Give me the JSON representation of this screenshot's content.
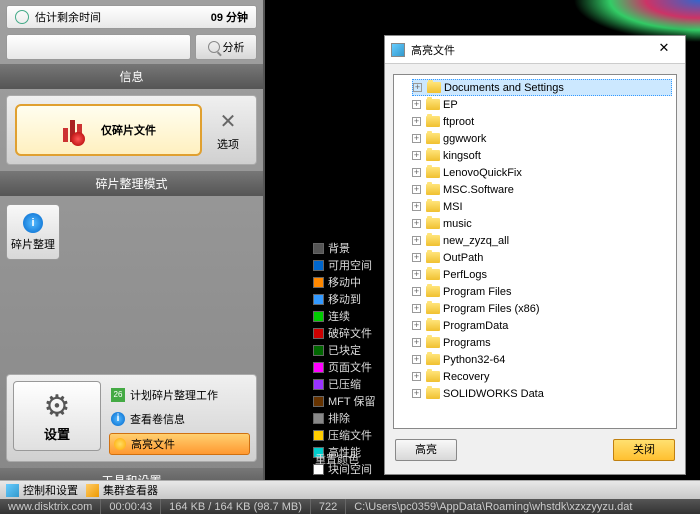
{
  "timer": {
    "label": "估计剩余时间",
    "value": "09 分钟"
  },
  "analyze_btn": "分析",
  "info_header": "信息",
  "mode": {
    "button": "仅碎片文件",
    "options": "选项",
    "header": "碎片整理模式"
  },
  "defrag_btn": "碎片整理",
  "tools": {
    "settings": "设置",
    "schedule": "计划碎片整理工作",
    "volinfo": "查看卷信息",
    "highlight": "高亮文件",
    "header": "工具和设置",
    "cal": "26"
  },
  "legend": [
    {
      "c": "#555555",
      "t": "背景"
    },
    {
      "c": "#0066cc",
      "t": "可用空间"
    },
    {
      "c": "#ff8800",
      "t": "移动中"
    },
    {
      "c": "#3399ff",
      "t": "移动到"
    },
    {
      "c": "#00cc00",
      "t": "连续"
    },
    {
      "c": "#cc0000",
      "t": "破碎文件"
    },
    {
      "c": "#006600",
      "t": "已块定"
    },
    {
      "c": "#ff00ff",
      "t": "页面文件"
    },
    {
      "c": "#9933ff",
      "t": "已压缩"
    },
    {
      "c": "#663300",
      "t": "MFT 保留"
    },
    {
      "c": "#888888",
      "t": "排除"
    },
    {
      "c": "#ffcc00",
      "t": "压缩文件"
    },
    {
      "c": "#00cccc",
      "t": "高性能"
    },
    {
      "c": "#ffffff",
      "t": "块间空间"
    }
  ],
  "reset_colors": "重置颜色",
  "dialog": {
    "title": "高亮文件",
    "highlight_btn": "高亮",
    "close_btn": "关闭",
    "items": [
      "Documents and Settings",
      "EP",
      "ftproot",
      "ggwwork",
      "kingsoft",
      "LenovoQuickFix",
      "MSC.Software",
      "MSI",
      "music",
      "new_zyzq_all",
      "OutPath",
      "PerfLogs",
      "Program Files",
      "Program Files (x86)",
      "ProgramData",
      "Programs",
      "Python32-64",
      "Recovery",
      "SOLIDWORKS Data"
    ]
  },
  "taskbar": {
    "control": "控制和设置",
    "cluster": "集群查看器"
  },
  "status": {
    "url": "www.disktrix.com",
    "time": "00:00:43",
    "mem": "164 KB / 164 KB (98.7 MB)",
    "num": "722",
    "path": "C:\\Users\\pc0359\\AppData\\Roaming\\whstdk\\xzxzyyzu.dat"
  }
}
